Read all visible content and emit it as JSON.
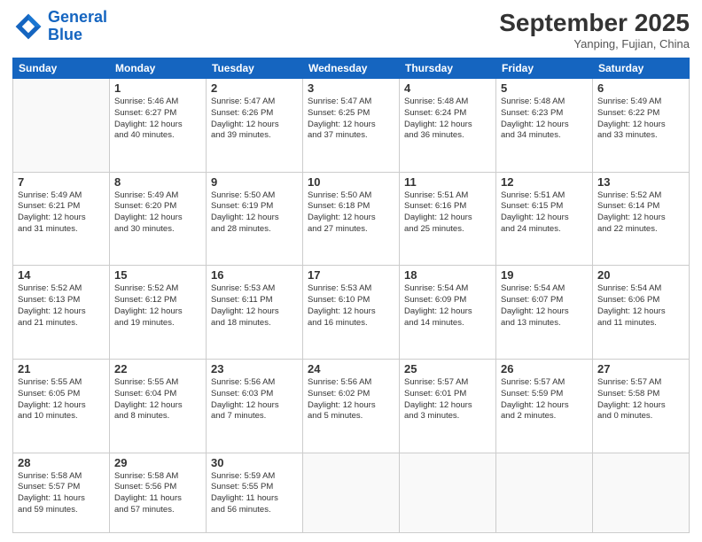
{
  "header": {
    "logo_line1": "General",
    "logo_line2": "Blue",
    "month": "September 2025",
    "location": "Yanping, Fujian, China"
  },
  "weekdays": [
    "Sunday",
    "Monday",
    "Tuesday",
    "Wednesday",
    "Thursday",
    "Friday",
    "Saturday"
  ],
  "weeks": [
    [
      {
        "day": "",
        "info": ""
      },
      {
        "day": "1",
        "info": "Sunrise: 5:46 AM\nSunset: 6:27 PM\nDaylight: 12 hours\nand 40 minutes."
      },
      {
        "day": "2",
        "info": "Sunrise: 5:47 AM\nSunset: 6:26 PM\nDaylight: 12 hours\nand 39 minutes."
      },
      {
        "day": "3",
        "info": "Sunrise: 5:47 AM\nSunset: 6:25 PM\nDaylight: 12 hours\nand 37 minutes."
      },
      {
        "day": "4",
        "info": "Sunrise: 5:48 AM\nSunset: 6:24 PM\nDaylight: 12 hours\nand 36 minutes."
      },
      {
        "day": "5",
        "info": "Sunrise: 5:48 AM\nSunset: 6:23 PM\nDaylight: 12 hours\nand 34 minutes."
      },
      {
        "day": "6",
        "info": "Sunrise: 5:49 AM\nSunset: 6:22 PM\nDaylight: 12 hours\nand 33 minutes."
      }
    ],
    [
      {
        "day": "7",
        "info": "Sunrise: 5:49 AM\nSunset: 6:21 PM\nDaylight: 12 hours\nand 31 minutes."
      },
      {
        "day": "8",
        "info": "Sunrise: 5:49 AM\nSunset: 6:20 PM\nDaylight: 12 hours\nand 30 minutes."
      },
      {
        "day": "9",
        "info": "Sunrise: 5:50 AM\nSunset: 6:19 PM\nDaylight: 12 hours\nand 28 minutes."
      },
      {
        "day": "10",
        "info": "Sunrise: 5:50 AM\nSunset: 6:18 PM\nDaylight: 12 hours\nand 27 minutes."
      },
      {
        "day": "11",
        "info": "Sunrise: 5:51 AM\nSunset: 6:16 PM\nDaylight: 12 hours\nand 25 minutes."
      },
      {
        "day": "12",
        "info": "Sunrise: 5:51 AM\nSunset: 6:15 PM\nDaylight: 12 hours\nand 24 minutes."
      },
      {
        "day": "13",
        "info": "Sunrise: 5:52 AM\nSunset: 6:14 PM\nDaylight: 12 hours\nand 22 minutes."
      }
    ],
    [
      {
        "day": "14",
        "info": "Sunrise: 5:52 AM\nSunset: 6:13 PM\nDaylight: 12 hours\nand 21 minutes."
      },
      {
        "day": "15",
        "info": "Sunrise: 5:52 AM\nSunset: 6:12 PM\nDaylight: 12 hours\nand 19 minutes."
      },
      {
        "day": "16",
        "info": "Sunrise: 5:53 AM\nSunset: 6:11 PM\nDaylight: 12 hours\nand 18 minutes."
      },
      {
        "day": "17",
        "info": "Sunrise: 5:53 AM\nSunset: 6:10 PM\nDaylight: 12 hours\nand 16 minutes."
      },
      {
        "day": "18",
        "info": "Sunrise: 5:54 AM\nSunset: 6:09 PM\nDaylight: 12 hours\nand 14 minutes."
      },
      {
        "day": "19",
        "info": "Sunrise: 5:54 AM\nSunset: 6:07 PM\nDaylight: 12 hours\nand 13 minutes."
      },
      {
        "day": "20",
        "info": "Sunrise: 5:54 AM\nSunset: 6:06 PM\nDaylight: 12 hours\nand 11 minutes."
      }
    ],
    [
      {
        "day": "21",
        "info": "Sunrise: 5:55 AM\nSunset: 6:05 PM\nDaylight: 12 hours\nand 10 minutes."
      },
      {
        "day": "22",
        "info": "Sunrise: 5:55 AM\nSunset: 6:04 PM\nDaylight: 12 hours\nand 8 minutes."
      },
      {
        "day": "23",
        "info": "Sunrise: 5:56 AM\nSunset: 6:03 PM\nDaylight: 12 hours\nand 7 minutes."
      },
      {
        "day": "24",
        "info": "Sunrise: 5:56 AM\nSunset: 6:02 PM\nDaylight: 12 hours\nand 5 minutes."
      },
      {
        "day": "25",
        "info": "Sunrise: 5:57 AM\nSunset: 6:01 PM\nDaylight: 12 hours\nand 3 minutes."
      },
      {
        "day": "26",
        "info": "Sunrise: 5:57 AM\nSunset: 5:59 PM\nDaylight: 12 hours\nand 2 minutes."
      },
      {
        "day": "27",
        "info": "Sunrise: 5:57 AM\nSunset: 5:58 PM\nDaylight: 12 hours\nand 0 minutes."
      }
    ],
    [
      {
        "day": "28",
        "info": "Sunrise: 5:58 AM\nSunset: 5:57 PM\nDaylight: 11 hours\nand 59 minutes."
      },
      {
        "day": "29",
        "info": "Sunrise: 5:58 AM\nSunset: 5:56 PM\nDaylight: 11 hours\nand 57 minutes."
      },
      {
        "day": "30",
        "info": "Sunrise: 5:59 AM\nSunset: 5:55 PM\nDaylight: 11 hours\nand 56 minutes."
      },
      {
        "day": "",
        "info": ""
      },
      {
        "day": "",
        "info": ""
      },
      {
        "day": "",
        "info": ""
      },
      {
        "day": "",
        "info": ""
      }
    ]
  ]
}
